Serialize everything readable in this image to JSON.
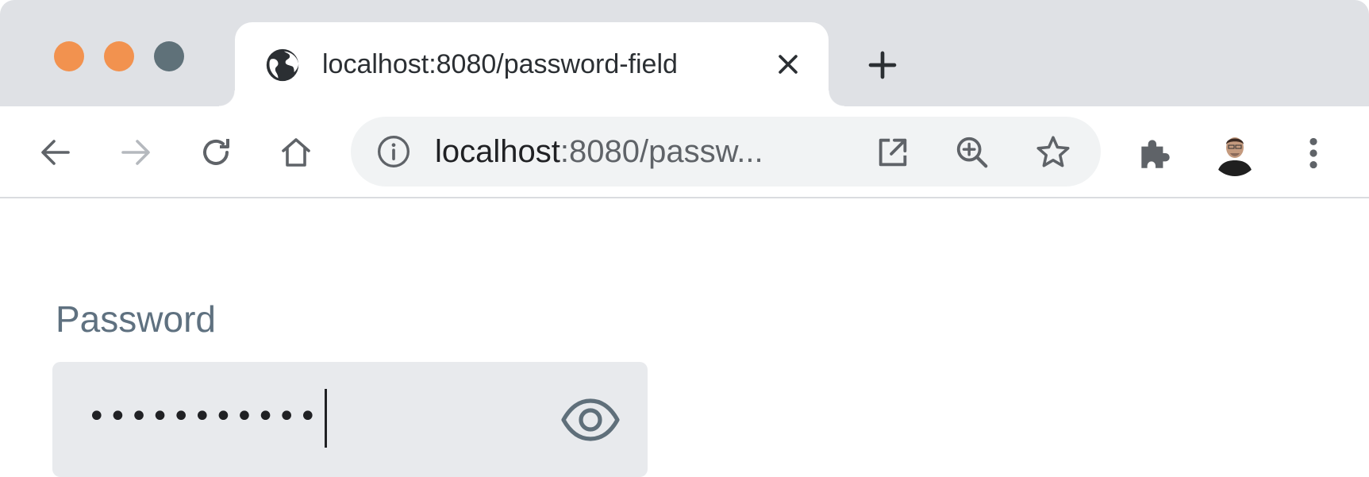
{
  "window": {
    "traffic_lights": {
      "close": "#f2924f",
      "minimize": "#f2924f",
      "maximize": "#5f7179"
    }
  },
  "tab": {
    "title": "localhost:8080/password-field",
    "favicon": "globe-icon",
    "close_icon": "close-icon"
  },
  "new_tab_icon": "plus-icon",
  "toolbar": {
    "back_icon": "arrow-left-icon",
    "forward_icon": "arrow-right-icon",
    "reload_icon": "reload-icon",
    "home_icon": "home-icon",
    "extensions_icon": "puzzle-piece-icon",
    "menu_icon": "vertical-dots-icon"
  },
  "omnibox": {
    "info_icon": "info-icon",
    "url_host": "localhost",
    "url_rest": ":8080/passw...",
    "share_icon": "open-in-new-icon",
    "zoom_icon": "zoom-in-icon",
    "bookmark_icon": "star-icon"
  },
  "page": {
    "password_label": "Password",
    "password_value": "•••••••••••",
    "visibility_icon": "eye-icon"
  },
  "colors": {
    "tabstrip": "#dfe1e5",
    "field_background": "#e8eaed",
    "label": "#5f7180"
  }
}
